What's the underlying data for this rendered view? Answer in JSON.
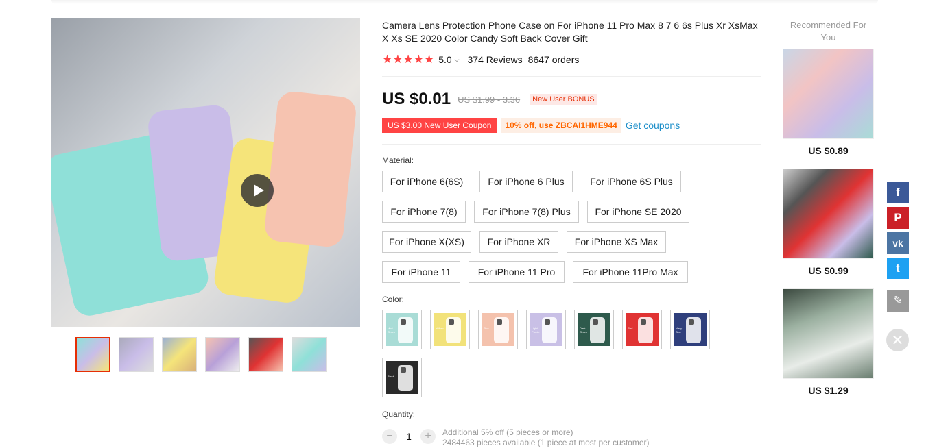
{
  "product": {
    "title": "Camera Lens Protection Phone Case on For iPhone 11 Pro Max 8 7 6 6s Plus Xr XsMax X Xs SE 2020 Color Candy Soft Back Cover Gift",
    "stars": "★★★★★",
    "rating": "5.0",
    "reviews": "374 Reviews",
    "orders": "8647 orders",
    "price": "US $0.01",
    "old_price": "US $1.99 - 3.36",
    "bonus": "New User BONUS",
    "coupon": "US $3.00 New User Coupon",
    "coupon_code": "10% off, use ZBCAI1HME944",
    "get_coupons": "Get coupons"
  },
  "material": {
    "label": "Material:",
    "options": [
      "For iPhone 6(6S)",
      "For iPhone 6 Plus",
      "For iPhone 6S Plus",
      "For iPhone 7(8)",
      "For iPhone 7(8) Plus",
      "For iPhone SE 2020",
      "For iPhone X(XS)",
      "For iPhone XR",
      "For iPhone XS Max",
      "For iPhone 11",
      "For iPhone 11 Pro",
      "For iPhone 11Pro Max"
    ]
  },
  "color": {
    "label": "Color:",
    "swatches": [
      {
        "color": "#a9dcd6",
        "text": "Mint Green"
      },
      {
        "color": "#f2e27a",
        "text": "Yellow"
      },
      {
        "color": "#f4c2ad",
        "text": "Pink"
      },
      {
        "color": "#c9c0e6",
        "text": "Light Purple"
      },
      {
        "color": "#2e5a4c",
        "text": "Dark Green"
      },
      {
        "color": "#e03333",
        "text": "Red"
      },
      {
        "color": "#2f3f7c",
        "text": "Navy Blue"
      },
      {
        "color": "#2a2a2a",
        "text": "Black"
      }
    ]
  },
  "quantity": {
    "label": "Quantity:",
    "minus": "−",
    "value": "1",
    "plus": "+",
    "note1": "Additional 5% off (5 pieces or more)",
    "note2": "2484463 pieces available (1 piece at most per customer)"
  },
  "recommended": {
    "title": "Recommended For You",
    "items": [
      {
        "price": "US $0.89"
      },
      {
        "price": "US $0.99"
      },
      {
        "price": "US $1.29"
      }
    ]
  },
  "share": {
    "facebook": "f",
    "pinterest": "P",
    "vk": "vk",
    "twitter": "t",
    "edit": "✎",
    "close": "✕"
  },
  "colors": {
    "accent_red": "#e62e04",
    "link_blue": "#1b8ec9",
    "facebook": "#3b5998",
    "pinterest": "#cb2027",
    "vk": "#4c75a3",
    "twitter": "#1da1f2",
    "edit": "#999999"
  }
}
